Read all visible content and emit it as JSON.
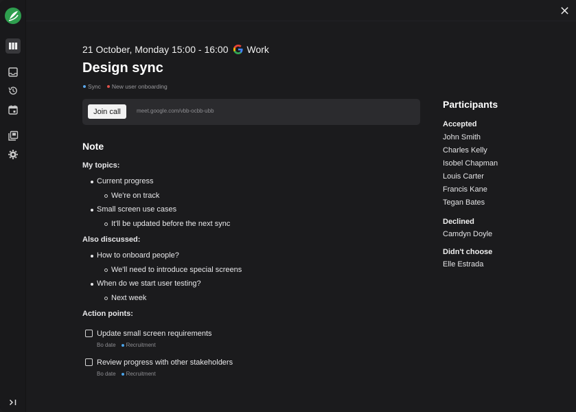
{
  "header": {
    "datetime": "21 October, Monday 15:00 - 16:00",
    "calendar": "Work",
    "close_icon": "close-icon"
  },
  "sidebar": {
    "logo": "app-logo",
    "items": [
      {
        "icon": "board-icon",
        "active": true
      },
      {
        "icon": "inbox-icon",
        "active": false
      },
      {
        "icon": "history-icon",
        "active": false
      },
      {
        "icon": "calendar-icon",
        "active": false
      },
      {
        "icon": "library-icon",
        "active": false
      },
      {
        "icon": "settings-icon",
        "active": false
      }
    ],
    "expand_icon": "expand-sidebar-icon"
  },
  "event": {
    "title": "Design sync",
    "tags": [
      {
        "label": "Sync",
        "color": "#5aa7ea"
      },
      {
        "label": "New user onboarding",
        "color": "#e0524b"
      }
    ],
    "join_label": "Join call",
    "meet_url": "meet.google.com/vbb-ocbb-ubb"
  },
  "note": {
    "heading": "Note",
    "sections": [
      {
        "label": "My topics:",
        "items": [
          {
            "text": "Current progress",
            "sub": "We're on track"
          },
          {
            "text": "Small screen use cases",
            "sub": "It'll be updated before the next sync"
          }
        ]
      },
      {
        "label": "Also discussed:",
        "items": [
          {
            "text": "How to onboard people?",
            "sub": "We'll need to introduce special screens"
          },
          {
            "text": "When do we start user testing?",
            "sub": "Next week"
          }
        ]
      }
    ],
    "action_label": "Action points:",
    "actions": [
      {
        "text": "Update small screen requirements",
        "date": "Bo date",
        "tag": "Recruitment",
        "tag_color": "#4aa3e8"
      },
      {
        "text": "Review progress with other stakeholders",
        "date": "Bo date",
        "tag": "Recruitment",
        "tag_color": "#4aa3e8"
      }
    ]
  },
  "participants": {
    "heading": "Participants",
    "accepted_label": "Accepted",
    "accepted": [
      "John Smith",
      "Charles Kelly",
      "Isobel Chapman",
      "Louis Carter",
      "Francis Kane",
      "Tegan Bates"
    ],
    "declined_label": "Declined",
    "declined": [
      "Camdyn Doyle"
    ],
    "undecided_label": "Didn't choose",
    "undecided": [
      "Elle Estrada"
    ]
  }
}
